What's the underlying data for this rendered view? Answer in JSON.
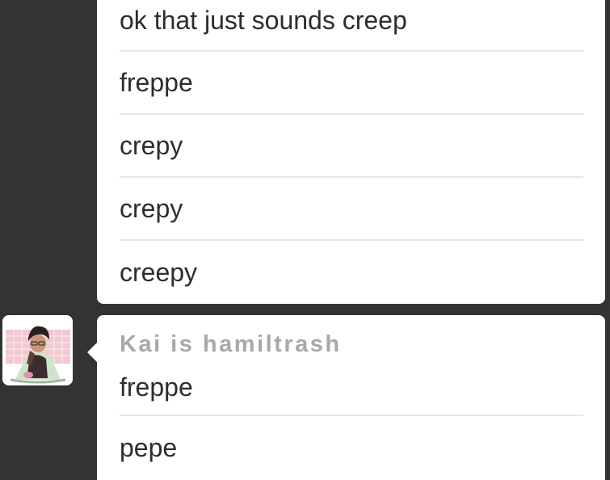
{
  "group_prev": {
    "messages": [
      "ok that just sounds creep",
      "freppe",
      "crepy",
      "crepy",
      "creepy"
    ]
  },
  "group_current": {
    "sender": "Kai is hamiltrash",
    "messages": [
      "freppe",
      "pepe"
    ]
  },
  "colors": {
    "background": "#333333",
    "bubble": "#ffffff",
    "sender": "#a8a8a8",
    "text": "#2d2d2d"
  }
}
